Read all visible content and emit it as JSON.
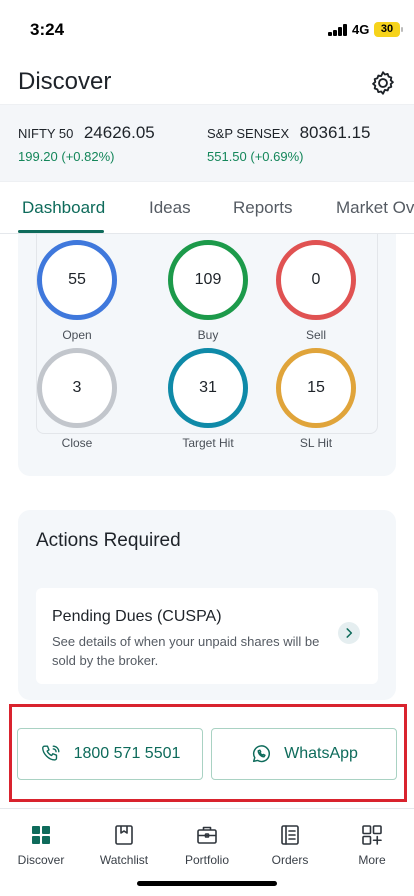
{
  "status_bar": {
    "time": "3:24",
    "network": "4G",
    "battery": "30"
  },
  "header": {
    "title": "Discover",
    "settings_icon": "gear-icon"
  },
  "indices": [
    {
      "name": "NIFTY 50",
      "value": "24626.05",
      "change": "199.20  (+0.82%)"
    },
    {
      "name": "S&P SENSEX",
      "value": "80361.15",
      "change": "551.50  (+0.69%)"
    }
  ],
  "tabs": [
    {
      "label": "Dashboard",
      "active": true
    },
    {
      "label": "Ideas",
      "active": false
    },
    {
      "label": "Reports",
      "active": false
    },
    {
      "label": "Market Ov",
      "active": false
    }
  ],
  "stats": [
    {
      "value": "55",
      "label": "Open",
      "color": "#3f78dc"
    },
    {
      "value": "109",
      "label": "Buy",
      "color": "#1c9a4a"
    },
    {
      "value": "0",
      "label": "Sell",
      "color": "#e05252"
    },
    {
      "value": "3",
      "label": "Close",
      "color": "#c2c6cc"
    },
    {
      "value": "31",
      "label": "Target Hit",
      "color": "#0f8aa8"
    },
    {
      "value": "15",
      "label": "SL Hit",
      "color": "#e0a43a"
    }
  ],
  "actions": {
    "title": "Actions Required",
    "pending_dues": {
      "title": "Pending Dues (CUSPA)",
      "description": "See details of when your unpaid shares will be sold by the broker."
    }
  },
  "contact": {
    "phone_label": "1800 571 5501",
    "whatsapp_label": "WhatsApp"
  },
  "bottom_nav": [
    {
      "label": "Discover",
      "icon": "grid-icon"
    },
    {
      "label": "Watchlist",
      "icon": "bookmark-icon"
    },
    {
      "label": "Portfolio",
      "icon": "briefcase-icon"
    },
    {
      "label": "Orders",
      "icon": "orders-icon"
    },
    {
      "label": "More",
      "icon": "apps-add-icon"
    }
  ],
  "colors": {
    "accent": "#0e6b5b",
    "positive": "#14865a",
    "highlight": "#d9232e"
  }
}
